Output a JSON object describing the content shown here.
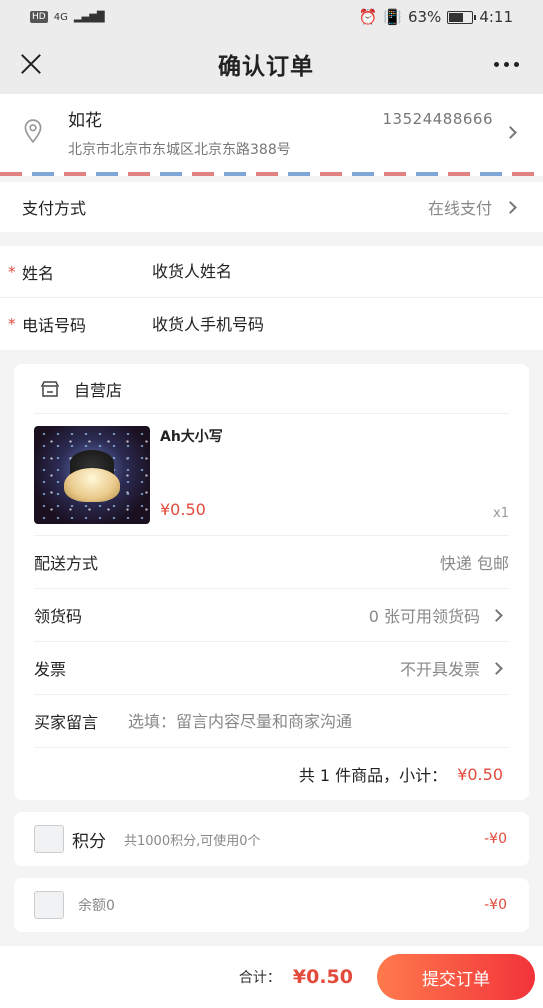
{
  "status": {
    "network": "4G",
    "battery": "63%",
    "time": "4:11"
  },
  "nav": {
    "title": "确认订单"
  },
  "address": {
    "name": "如花",
    "phone": "13524488666",
    "detail": "北京市北京市东城区北京东路388号"
  },
  "payment": {
    "label": "支付方式",
    "value": "在线支付"
  },
  "form": {
    "name_label": "姓名",
    "name_placeholder": "收货人姓名",
    "phone_label": "电话号码",
    "phone_placeholder": "收货人手机号码"
  },
  "store": {
    "name": "自营店",
    "product": {
      "title": "Ah大小写",
      "price": "¥0.50",
      "qty": "x1"
    },
    "delivery": {
      "label": "配送方式",
      "value": "快递 包邮"
    },
    "coupon": {
      "label": "领货码",
      "value": "0 张可用领货码"
    },
    "invoice": {
      "label": "发票",
      "value": "不开具发票"
    },
    "memo": {
      "label": "买家留言",
      "placeholder": "选填：留言内容尽量和商家沟通"
    },
    "subtotal": {
      "text": "共 1 件商品，小计：",
      "amount": "¥0.50"
    }
  },
  "points": {
    "label": "积分",
    "desc": "共1000积分,可使用0个",
    "value": "-¥0"
  },
  "balance": {
    "desc": "余额0",
    "value": "-¥0"
  },
  "footer": {
    "total_label": "合计：",
    "total": "¥0.50",
    "submit": "提交订单"
  },
  "colors": {
    "accent": "#e24a3b",
    "button_start": "#ff7a4d",
    "button_end": "#f2333a"
  }
}
